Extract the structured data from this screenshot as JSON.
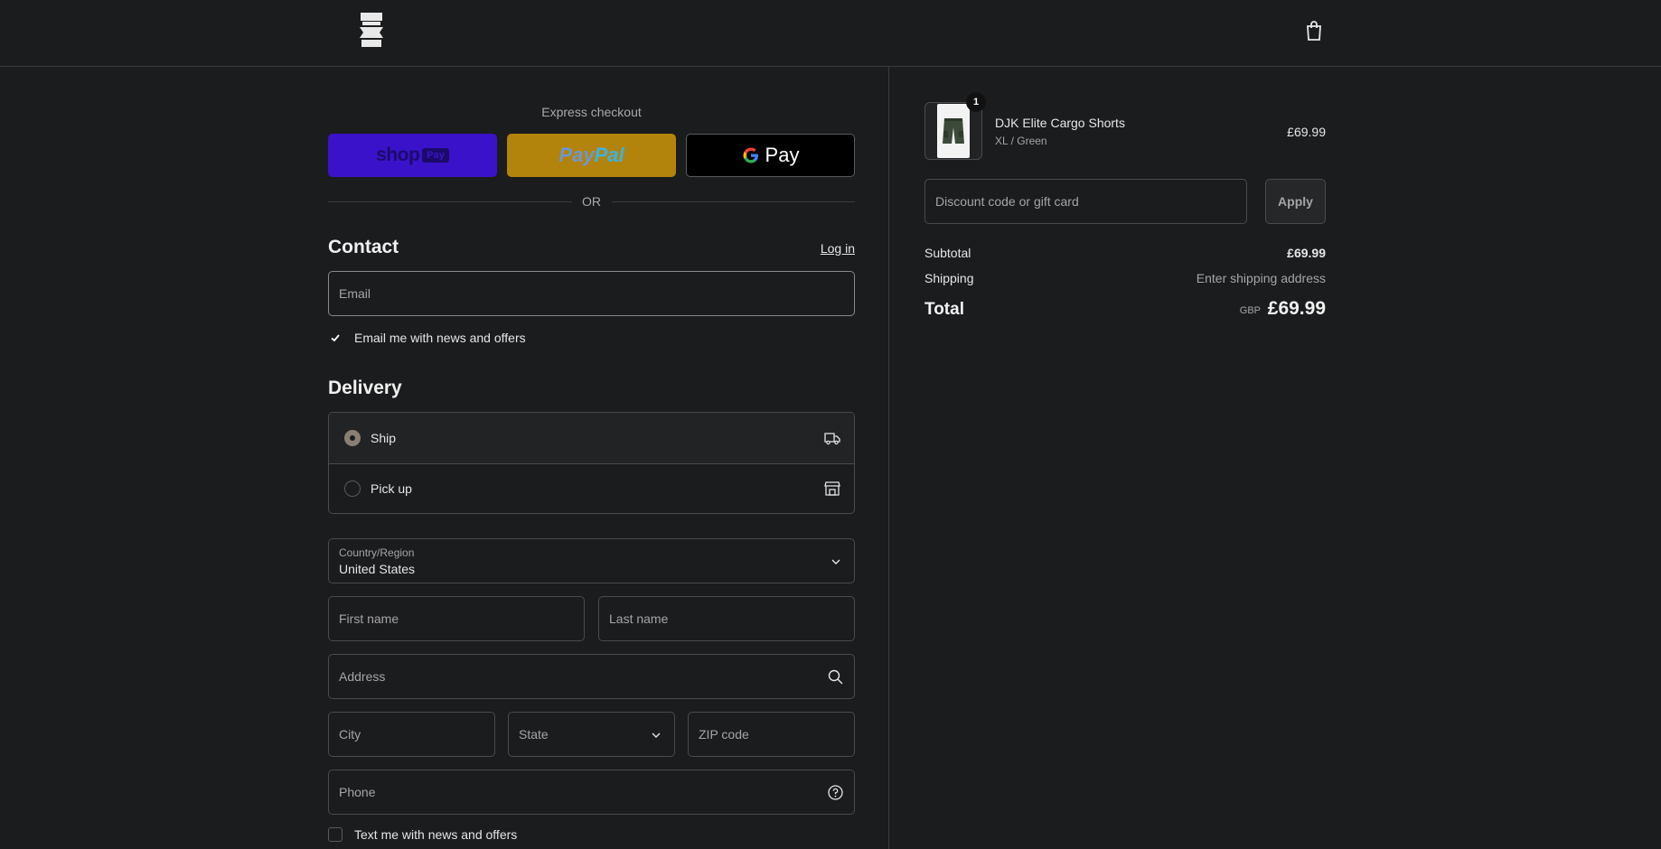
{
  "header": {
    "logo_icon": "brand-logo-icon",
    "cart_icon": "shopping-bag-icon"
  },
  "express": {
    "title": "Express checkout",
    "shop_pay": {
      "word": "shop",
      "tag": "Pay",
      "color": "#3a12c9"
    },
    "paypal": {
      "part1": "Pay",
      "part2": "Pal",
      "color": "#b3840b"
    },
    "gpay": {
      "label": "Pay",
      "color": "#000000"
    },
    "or_label": "OR"
  },
  "contact": {
    "title": "Contact",
    "login_label": "Log in",
    "email_placeholder": "Email",
    "news_checkbox_label": "Email me with news and offers",
    "news_checked": true
  },
  "delivery": {
    "title": "Delivery",
    "options": [
      {
        "label": "Ship",
        "selected": true,
        "icon": "truck-icon"
      },
      {
        "label": "Pick up",
        "selected": false,
        "icon": "store-icon"
      }
    ],
    "country_label": "Country/Region",
    "country_value": "United States",
    "first_name_placeholder": "First name",
    "last_name_placeholder": "Last name",
    "address_placeholder": "Address",
    "city_placeholder": "City",
    "state_placeholder": "State",
    "zip_placeholder": "ZIP code",
    "phone_placeholder": "Phone",
    "text_checkbox_label": "Text me with news and offers",
    "text_checked": false
  },
  "summary": {
    "product": {
      "name": "DJK Elite Cargo Shorts",
      "variant": "XL / Green",
      "price": "£69.99",
      "quantity": "1"
    },
    "discount_placeholder": "Discount code or gift card",
    "apply_label": "Apply",
    "subtotal_label": "Subtotal",
    "subtotal_value": "£69.99",
    "shipping_label": "Shipping",
    "shipping_value": "Enter shipping address",
    "total_label": "Total",
    "total_currency": "GBP",
    "total_value": "£69.99"
  }
}
